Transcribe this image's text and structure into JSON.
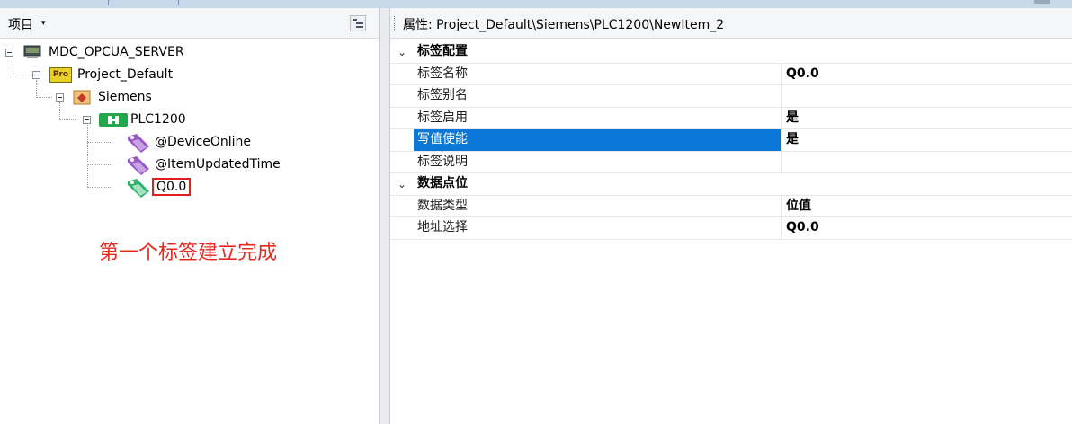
{
  "left_panel": {
    "title": "项目",
    "dropdown_glyph": "▾",
    "tree": [
      {
        "label": "MDC_OPCUA_SERVER",
        "icon": "server-icon"
      },
      {
        "label": "Project_Default",
        "icon": "project-icon",
        "icon_text": "Pro"
      },
      {
        "label": "Siemens",
        "icon": "vendor-icon"
      },
      {
        "label": "PLC1200",
        "icon": "device-icon"
      },
      {
        "label": "@DeviceOnline",
        "icon": "tag-icon",
        "icon_color": "#9b59c7"
      },
      {
        "label": "@ItemUpdatedTime",
        "icon": "tag-icon",
        "icon_color": "#9b59c7"
      },
      {
        "label": "Q0.0",
        "icon": "tag-icon",
        "icon_color": "#2fb36b",
        "selected": true
      }
    ]
  },
  "annotation": "第一个标签建立完成",
  "right_panel": {
    "path_text": "属性: Project_Default\\Siemens\\PLC1200\\NewItem_2",
    "categories": [
      {
        "label": "标签配置",
        "rows": [
          {
            "name": "标签名称",
            "value": "Q0.0"
          },
          {
            "name": "标签别名",
            "value": ""
          },
          {
            "name": "标签启用",
            "value": "是"
          },
          {
            "name": "写值使能",
            "value": "是",
            "selected": true
          },
          {
            "name": "标签说明",
            "value": ""
          }
        ]
      },
      {
        "label": "数据点位",
        "rows": [
          {
            "name": "数据类型",
            "value": "位值"
          },
          {
            "name": "地址选择",
            "value": "Q0.0"
          }
        ]
      }
    ]
  },
  "colors": {
    "selection": "#0b78d7",
    "annotation": "#e8291f",
    "highlight_box": "#e02020"
  }
}
